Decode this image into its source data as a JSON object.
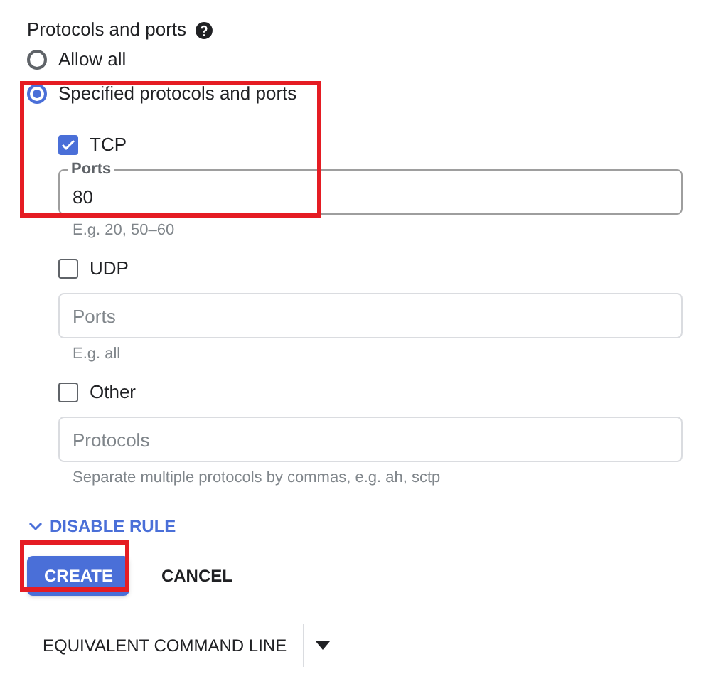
{
  "section": {
    "title": "Protocols and ports"
  },
  "options": [
    {
      "label": "Allow all",
      "selected": false
    },
    {
      "label": "Specified protocols and ports",
      "selected": true
    }
  ],
  "protocols": [
    {
      "label": "TCP",
      "checked": true,
      "field": {
        "label": "Ports",
        "value": "80"
      },
      "hint": "E.g. 20, 50–60"
    },
    {
      "label": "UDP",
      "checked": false,
      "field": {
        "placeholder": "Ports"
      },
      "hint": "E.g. all"
    },
    {
      "label": "Other",
      "checked": false,
      "field": {
        "placeholder": "Protocols"
      },
      "hint": "Separate multiple protocols by commas, e.g. ah, sctp"
    }
  ],
  "toggle": {
    "label": "DISABLE RULE"
  },
  "buttons": [
    {
      "label": "CREATE",
      "kind": "primary"
    },
    {
      "label": "CANCEL",
      "kind": "text"
    }
  ],
  "command": {
    "label": "EQUIVALENT COMMAND LINE"
  }
}
